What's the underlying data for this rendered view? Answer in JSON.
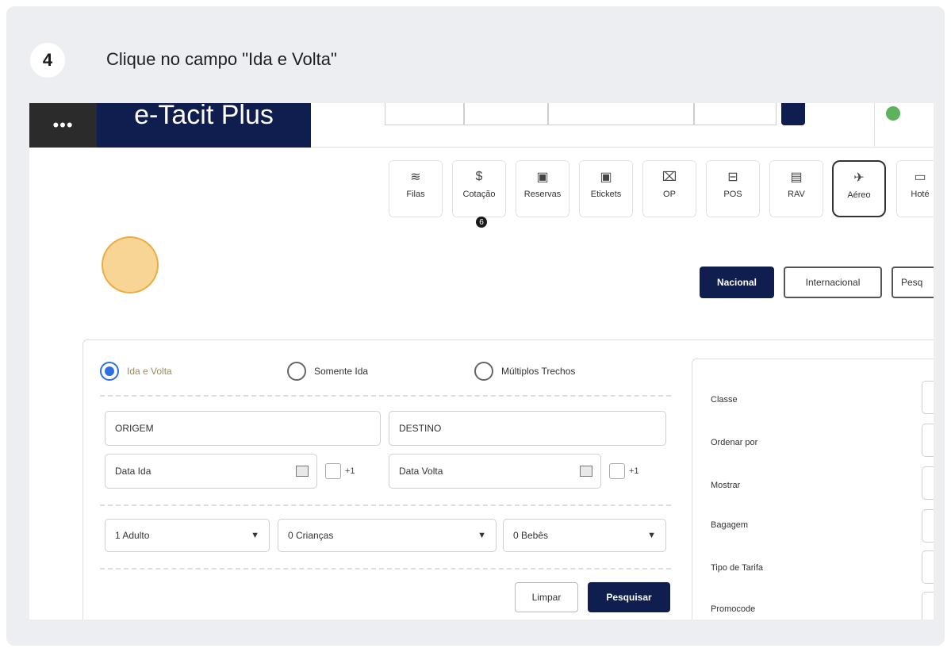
{
  "step": {
    "number": "4",
    "title": "Clique no campo \"Ida e Volta\""
  },
  "topbar": {
    "logo": "e-Tacit Plus"
  },
  "modules": [
    {
      "label": "Filas",
      "icon": "layers-icon",
      "glyph": "≋"
    },
    {
      "label": "Cotação",
      "icon": "dollar-coin-icon",
      "glyph": "$"
    },
    {
      "label": "Reservas",
      "icon": "calendar-icon",
      "glyph": "▣"
    },
    {
      "label": "Etickets",
      "icon": "calendar-ticket-icon",
      "glyph": "▣"
    },
    {
      "label": "OP",
      "icon": "ticket-icon",
      "glyph": "⌧"
    },
    {
      "label": "POS",
      "icon": "pos-icon",
      "glyph": "⊟"
    },
    {
      "label": "RAV",
      "icon": "document-icon",
      "glyph": "▤"
    },
    {
      "label": "Aéreo",
      "icon": "airplane-icon",
      "glyph": "✈"
    },
    {
      "label": "Hoté",
      "icon": "hotel-icon",
      "glyph": "▭"
    }
  ],
  "cotacao_badge": "6",
  "segments": {
    "nacional": "Nacional",
    "internacional": "Internacional",
    "pesquisa": "Pesq"
  },
  "trip_type": {
    "round_trip": "Ida e Volta",
    "one_way": "Somente Ida",
    "multi": "Múltiplos Trechos"
  },
  "form": {
    "origem": "ORIGEM",
    "destino": "DESTINO",
    "data_ida": "Data Ida",
    "data_volta": "Data Volta",
    "plus_one": "+1",
    "adultos": "1 Adulto",
    "criancas": "0 Crianças",
    "bebes": "0 Bebês"
  },
  "buttons": {
    "limpar": "Limpar",
    "pesquisar": "Pesquisar"
  },
  "options_panel": {
    "classe": "Classe",
    "ordenar": "Ordenar por",
    "mostrar": "Mostrar",
    "bagagem": "Bagagem",
    "tipo_tarifa": "Tipo de Tarifa",
    "promocode": "Promocode"
  },
  "colors": {
    "primary": "#0f1e4f",
    "radio_selected": "#2f6fe0",
    "highlight": "#f2b23c"
  }
}
